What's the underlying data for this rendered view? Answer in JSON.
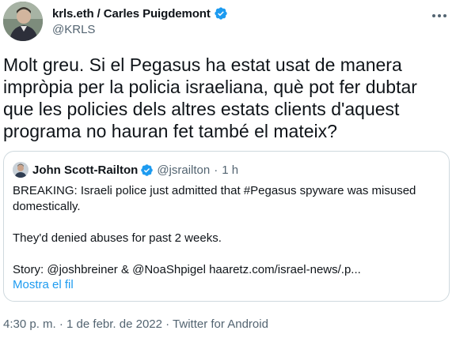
{
  "author": {
    "display_name": "krls.eth / Carles Puigdemont",
    "handle": "@KRLS",
    "verified": true
  },
  "tweet": {
    "text": "Molt greu. Si el Pegasus ha estat usat de manera impròpia per la policia israeliana, què pot fer dubtar que les policies dels altres estats clients d'aquest programa no hauran fet també el mateix?"
  },
  "quoted_tweet": {
    "display_name": "John Scott-Railton",
    "handle": "@jsrailton",
    "separator": "·",
    "time": "1 h",
    "lines": [
      "BREAKING: Israeli police just admitted that #Pegasus spyware was misused domestically.",
      "They'd denied abuses for past 2 weeks.",
      "Story: @joshbreiner & @NoaShpigel haaretz.com/israel-news/.p..."
    ],
    "show_thread": "Mostra el fil"
  },
  "meta": {
    "time": "4:30 p. m.",
    "sep1": " · ",
    "date": "1 de febr. de 2022",
    "sep2": " · ",
    "source": "Twitter for Android"
  },
  "colors": {
    "text": "#0f1419",
    "secondary": "#536471",
    "accent": "#1d9bf0",
    "border": "#cfd9de"
  },
  "icons": {
    "verified": "verified-badge-icon",
    "more": "more-options-icon"
  }
}
